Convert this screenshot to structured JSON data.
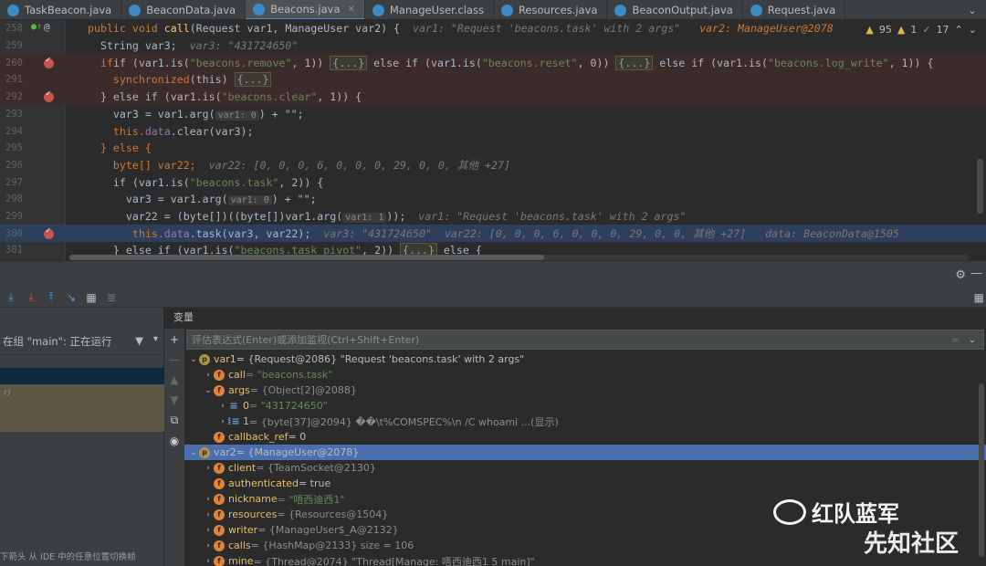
{
  "tabs": [
    {
      "label": "TaskBeacon.java",
      "active": false
    },
    {
      "label": "BeaconData.java",
      "active": false
    },
    {
      "label": "Beacons.java",
      "active": true
    },
    {
      "label": "ManageUser.class",
      "active": false
    },
    {
      "label": "Resources.java",
      "active": false
    },
    {
      "label": "BeaconOutput.java",
      "active": false
    },
    {
      "label": "Request.java",
      "active": false
    }
  ],
  "inspections": {
    "warnings": "95",
    "errors": "1",
    "ok": "17"
  },
  "lines": [
    {
      "n": "258",
      "kind": "normal"
    },
    {
      "n": "259",
      "kind": "normal"
    },
    {
      "n": "260",
      "kind": "bp"
    },
    {
      "n": "291",
      "kind": "normal"
    },
    {
      "n": "292",
      "kind": "bp"
    },
    {
      "n": "293",
      "kind": "normal"
    },
    {
      "n": "294",
      "kind": "normal"
    },
    {
      "n": "295",
      "kind": "normal"
    },
    {
      "n": "296",
      "kind": "normal"
    },
    {
      "n": "297",
      "kind": "normal"
    },
    {
      "n": "298",
      "kind": "normal"
    },
    {
      "n": "299",
      "kind": "normal"
    },
    {
      "n": "300",
      "kind": "exec"
    },
    {
      "n": "301",
      "kind": "normal"
    }
  ],
  "code": {
    "l258_kw": "public void ",
    "l258_fn": "call",
    "l258_rest": "(Request var1, ManageUser var2) {",
    "l258_hint1": "var1: \"Request 'beacons.task' with 2 args\"",
    "l258_hint2": "var2: ManageUser@2078",
    "l259_code": "String var3;",
    "l259_hint": "var3: \"431724650\"",
    "l260_a": "if (var1.is(",
    "l260_s1": "\"beacons.remove\"",
    "l260_b": ", 1)) ",
    "l260_fold1": "{...}",
    "l260_c": " else if (var1.is(",
    "l260_s2": "\"beacons.reset\"",
    "l260_d": ", 0)) ",
    "l260_fold2": "{...}",
    "l260_e": " else if (var1.is(",
    "l260_s3": "\"beacons.log_write\"",
    "l260_f": ", 1)) {",
    "l291_kw": "synchronized",
    "l291_rest": "(this) ",
    "l291_fold": "{...}",
    "l292_a": "} else if (var1.is(",
    "l292_s": "\"beacons.clear\"",
    "l292_b": ", 1)) {",
    "l293_a": "var3 = var1.arg(",
    "l293_p": "var1: 0",
    "l293_b": ") + \"\";",
    "l294_a": "this.",
    "l294_f": "data",
    "l294_b": ".clear(var3);",
    "l295": "} else {",
    "l296_code": "byte[] var22;",
    "l296_hint": "var22: [0, 0, 0, 6, 0, 0, 0, 29, 0, 0, 其他 +27]",
    "l297_a": "if (var1.is(",
    "l297_s": "\"beacons.task\"",
    "l297_b": ", 2)) {",
    "l298_a": "var3 = var1.arg(",
    "l298_p": "var1: 0",
    "l298_b": ") + \"\";",
    "l299_a": "var22 = (byte[])((byte[])var1.arg(",
    "l299_p": "var1: 1",
    "l299_b": "));",
    "l299_hint": "var1: \"Request 'beacons.task' with 2 args\"",
    "l300_a": "this.",
    "l300_f": "data",
    "l300_b": ".task(var3, var22);",
    "l300_hint1": "var3: \"431724650\"",
    "l300_hint2": "var22: [0, 0, 0, 6, 0, 0, 0, 29, 0, 0, 其他 +27]",
    "l300_hint3": "data: BeaconData@1505",
    "l301_a": "} else if (var1.is(",
    "l301_s": "\"beacons.task_pivot\"",
    "l301_b": ", 2)) ",
    "l301_fold": "{...}",
    "l301_c": " else {"
  },
  "frames": {
    "thread_label": "在组 \"main\": 正在运行",
    "alt_text": "r)",
    "footer": "下箭头 从 IDE 中的任意位置切换帧"
  },
  "variables": {
    "title": "变量",
    "eval_placeholder": "评估表达式(Enter)或添加监视(Ctrl+Shift+Enter)",
    "rows": [
      {
        "name": "var1",
        "text": " = {Request@2086} \"Request 'beacons.task' with 2 args\""
      },
      {
        "name": "call",
        "text": " = \"beacons.task\""
      },
      {
        "name": "args",
        "text": " = {Object[2]@2088}"
      },
      {
        "name": "0",
        "text": " = \"431724650\""
      },
      {
        "name": "1",
        "text": " = {byte[37]@2094} ��\\t%COMSPEC%\\n /C whoami ...(显示)"
      },
      {
        "name": "callback_ref",
        "text": " = 0"
      },
      {
        "name": "var2",
        "text": " = {ManageUser@2078}"
      },
      {
        "name": "client",
        "text": " = {TeamSocket@2130}"
      },
      {
        "name": "authenticated",
        "text": " = true"
      },
      {
        "name": "nickname",
        "text": " = \"唔西迪西1\""
      },
      {
        "name": "resources",
        "text": " = {Resources@1504}"
      },
      {
        "name": "writer",
        "text": " = {ManageUser$_A@2132}"
      },
      {
        "name": "calls",
        "text": " = {HashMap@2133}  size = 106"
      },
      {
        "name": "mine",
        "text": " = {Thread@2074} \"Thread[Manage: 唔西迪西1 5 main]\""
      }
    ]
  },
  "watermark": {
    "line1": "红队蓝军",
    "line2": "先知社区"
  }
}
